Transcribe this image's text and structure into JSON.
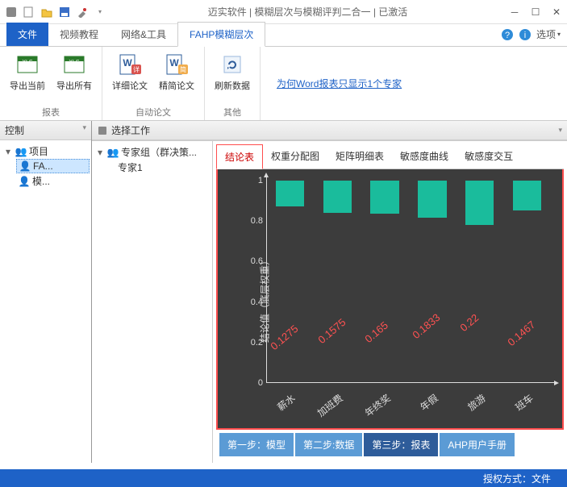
{
  "window": {
    "title": "迈实软件 | 模糊层次与模糊评判二合一 | 已激活"
  },
  "qat": {
    "new": "新建",
    "open": "打开",
    "save": "保存",
    "tools": "工具"
  },
  "tabs": {
    "file": "文件",
    "video": "视频教程",
    "net": "网络&工具",
    "fahp": "FAHP模糊层次",
    "options": "选项"
  },
  "ribbon": {
    "group1": {
      "name": "报表",
      "export_current": "导出当前",
      "export_all": "导出所有"
    },
    "group2": {
      "name": "自动论文",
      "detail": "详细论文",
      "brief": "精简论文"
    },
    "group3": {
      "name": "其他",
      "refresh": "刷新数据"
    },
    "link": "为何Word报表只显示1个专家"
  },
  "left_panel": {
    "title": "控制",
    "root": "项目",
    "n1": "FA...",
    "n2": "模..."
  },
  "right_panel": {
    "title": "选择工作",
    "root": "专家组（群决策...",
    "child": "专家1"
  },
  "subtabs": {
    "t1": "结论表",
    "t2": "权重分配图",
    "t3": "矩阵明细表",
    "t4": "敏感度曲线",
    "t5": "敏感度交互"
  },
  "chart_data": {
    "type": "bar",
    "ylabel": "结论值（底层权重）",
    "ylim": [
      0,
      1
    ],
    "yticks": [
      0,
      0.2,
      0.4,
      0.6,
      0.8,
      1
    ],
    "categories": [
      "薪水",
      "加班费",
      "年终奖",
      "年假",
      "旅游",
      "班车"
    ],
    "values": [
      0.1275,
      0.1575,
      0.165,
      0.1833,
      0.22,
      0.1467
    ]
  },
  "steps": {
    "s1": "第一步：模型",
    "s2": "第二步:数据",
    "s3": "第三步：报表",
    "s4": "AHP用户手册"
  },
  "status": {
    "auth": "授权方式：文件"
  }
}
